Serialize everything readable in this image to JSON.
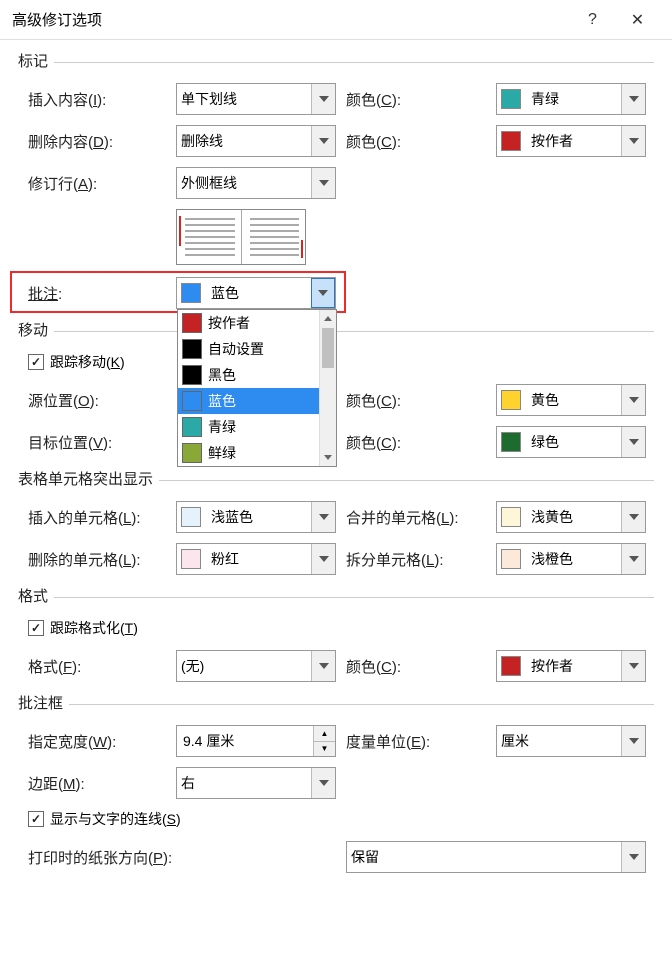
{
  "title": "高级修订选项",
  "sections": {
    "marking": {
      "title": "标记",
      "insert_label": "插入内容(I):",
      "insert_value": "单下划线",
      "insert_color_label": "颜色(C):",
      "insert_color_value": "青绿",
      "insert_color_hex": "#2aa9a6",
      "delete_label": "删除内容(D):",
      "delete_value": "删除线",
      "delete_color_label": "颜色(C):",
      "delete_color_value": "按作者",
      "changed_lines_label": "修订行(A):",
      "changed_lines_value": "外侧框线",
      "comments_label": "批注:",
      "comments_value": "蓝色",
      "dropdown_items": [
        {
          "label": "按作者",
          "color": "#c52224"
        },
        {
          "label": "自动设置",
          "color": "#000000"
        },
        {
          "label": "黑色",
          "color": "#000000"
        },
        {
          "label": "蓝色",
          "color": "#2e8bef",
          "selected": true
        },
        {
          "label": "青绿",
          "color": "#2aa9a6"
        },
        {
          "label": "鲜绿",
          "color": "#8aa838"
        }
      ]
    },
    "moves": {
      "title": "移动",
      "track_moves_label": "跟踪移动(K)",
      "from_label": "源位置(O):",
      "from_color_label": "颜色(C):",
      "from_color_value": "黄色",
      "from_color_hex": "#ffd22e",
      "to_label": "目标位置(V):",
      "to_color_label": "颜色(C):",
      "to_color_value": "绿色",
      "to_color_hex": "#1e6b2f"
    },
    "table_cells": {
      "title": "表格单元格突出显示",
      "inserted_label": "插入的单元格(L):",
      "inserted_value": "浅蓝色",
      "inserted_hex": "#e5f1fb",
      "merged_label": "合并的单元格(L):",
      "merged_value": "浅黄色",
      "merged_hex": "#fdf6d9",
      "deleted_label": "删除的单元格(L):",
      "deleted_value": "粉红",
      "deleted_hex": "#fce6ee",
      "split_label": "拆分单元格(L):",
      "split_value": "浅橙色",
      "split_hex": "#fde9d9"
    },
    "formatting": {
      "title": "格式",
      "track_format_label": "跟踪格式化(T)",
      "format_label": "格式(F):",
      "format_value": "(无)",
      "format_color_label": "颜色(C):",
      "format_color_value": "按作者"
    },
    "balloons": {
      "title": "批注框",
      "width_label": "指定宽度(W):",
      "width_value": "9.4 厘米",
      "measure_label": "度量单位(E):",
      "measure_value": "厘米",
      "margin_label": "边距(M):",
      "margin_value": "右",
      "show_lines_label": "显示与文字的连线(S)",
      "print_orient_label": "打印时的纸张方向(P):",
      "print_orient_value": "保留"
    }
  }
}
